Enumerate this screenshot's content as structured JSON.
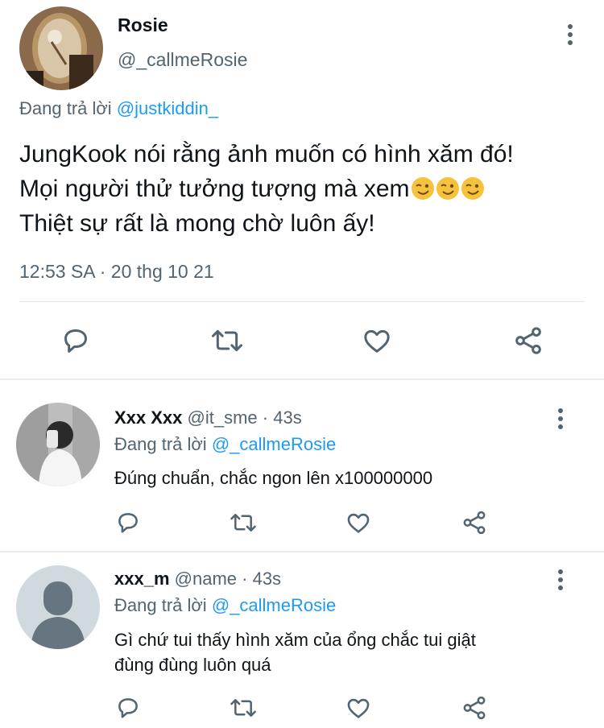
{
  "main_tweet": {
    "name": "Rosie",
    "handle": "@_callmeRosie",
    "reply_prefix": "Đang trả lời",
    "reply_to": "@justkiddin_",
    "text_line1": "JungKook nói rằng ảnh muốn có hình xăm đó!",
    "text_line2": "Mọi người thử tưởng tượng mà xem",
    "text_line3": "Thiệt sự rất là mong chờ luôn ấy!",
    "timestamp": "12:53 SA · 20 thg 10 21"
  },
  "replies": [
    {
      "name": "Xxx Xxx",
      "handle": "@it_sme",
      "time": "· 43s",
      "reply_prefix": "Đang trả lời",
      "reply_to": "@_callmeRosie",
      "text_line1": "Đúng chuẩn, chắc ngon lên x100000000",
      "text_line2": ""
    },
    {
      "name": "xxx_m",
      "handle": "@name",
      "time": "· 43s",
      "reply_prefix": "Đang trả lời",
      "reply_to": "@_callmeRosie",
      "text_line1": "Gì chứ tui thấy hình xăm của ổng chắc tui giật",
      "text_line2": "đùng đùng luôn quá"
    }
  ],
  "colors": {
    "muted": "#536471",
    "link": "#1d9bf0",
    "text": "#0f1419",
    "divider": "#e5e5e5"
  },
  "icons": [
    "reply-icon",
    "retweet-icon",
    "like-icon",
    "share-icon",
    "more-icon",
    "wink-emoji"
  ]
}
